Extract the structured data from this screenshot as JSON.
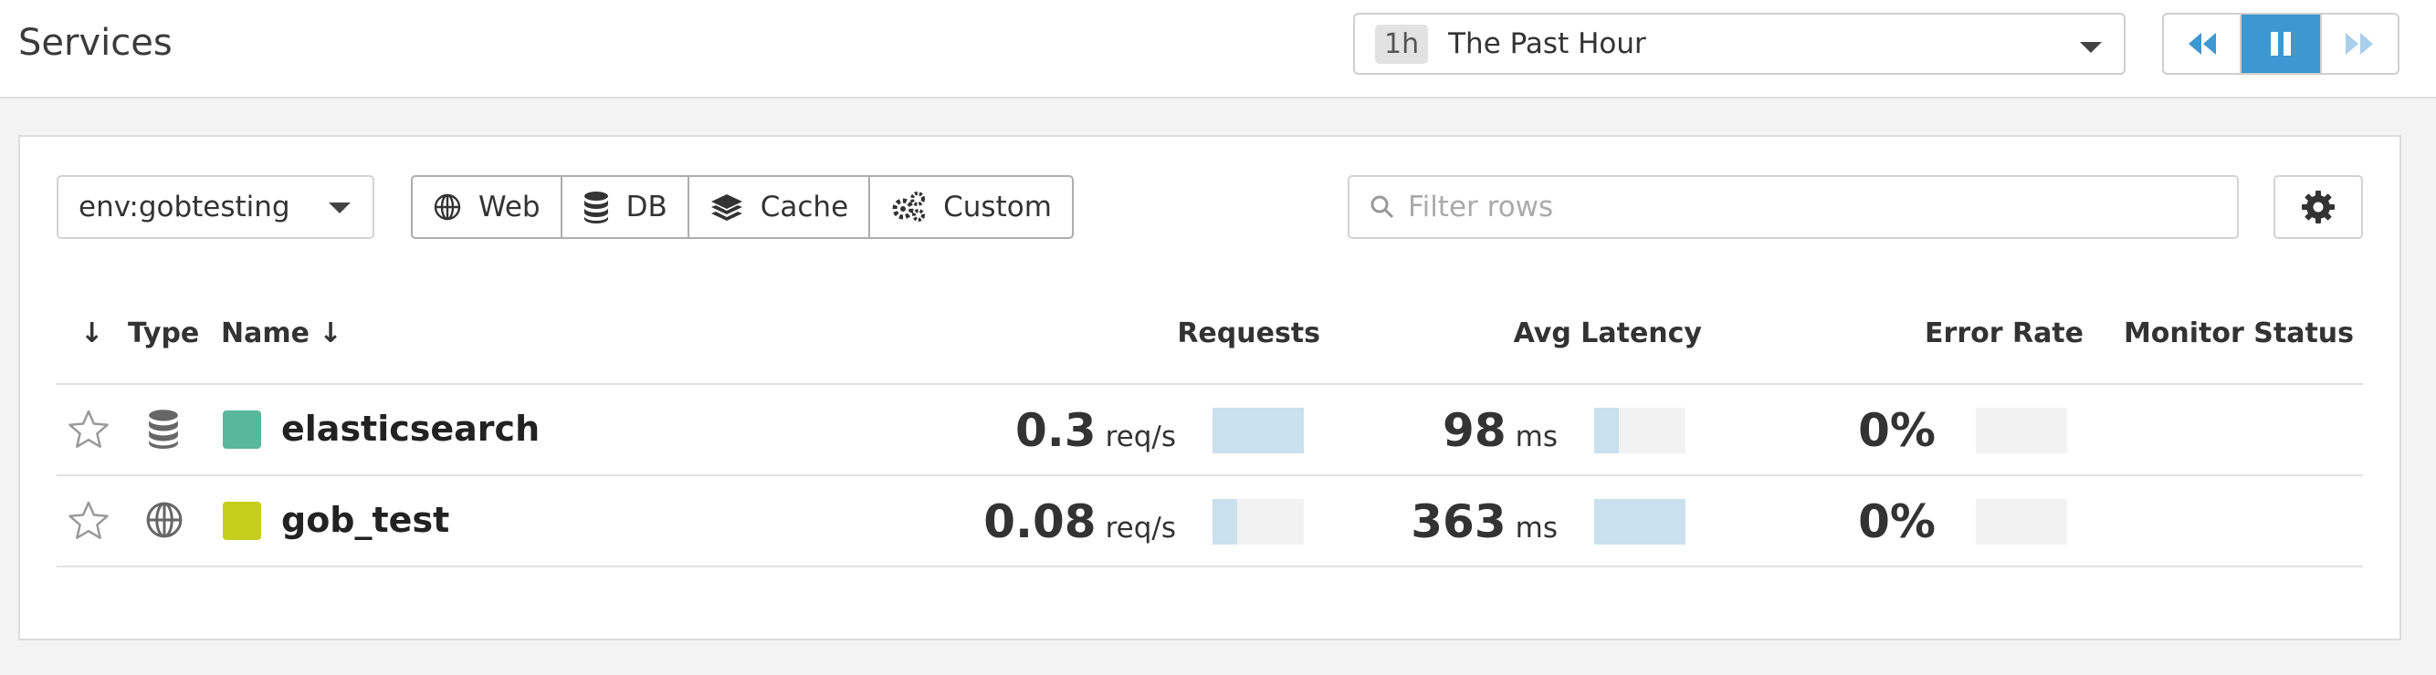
{
  "header": {
    "title": "Services",
    "time": {
      "badge": "1h",
      "label": "The Past Hour"
    }
  },
  "toolbar": {
    "env": "env:gobtesting",
    "types": [
      {
        "label": "Web",
        "icon": "globe-icon"
      },
      {
        "label": "DB",
        "icon": "database-icon"
      },
      {
        "label": "Cache",
        "icon": "layers-icon"
      },
      {
        "label": "Custom",
        "icon": "gears-icon"
      }
    ],
    "filter_placeholder": "Filter rows"
  },
  "table": {
    "sort_arrow": "↓",
    "columns": {
      "type": "Type",
      "name": "Name ↓",
      "requests": "Requests",
      "latency": "Avg Latency",
      "error_rate": "Error Rate",
      "monitor": "Monitor Status"
    },
    "rows": [
      {
        "name": "elasticsearch",
        "type_icon": "database-icon",
        "color": "#59b899",
        "requests": "0.3",
        "requests_unit": "req/s",
        "requests_fraction": 1.0,
        "latency": "98",
        "latency_unit": "ms",
        "latency_fraction": 0.27,
        "error_rate": "0%",
        "error_fraction": 0
      },
      {
        "name": "gob_test",
        "type_icon": "globe-icon",
        "color": "#c5cf1b",
        "requests": "0.08",
        "requests_unit": "req/s",
        "requests_fraction": 0.27,
        "latency": "363",
        "latency_unit": "ms",
        "latency_fraction": 1.0,
        "error_rate": "0%",
        "error_fraction": 0
      }
    ]
  },
  "colors": {
    "accent": "#3d98d1",
    "bar_fill": "#c9e1ee",
    "bar_track": "#f2f2f2"
  }
}
